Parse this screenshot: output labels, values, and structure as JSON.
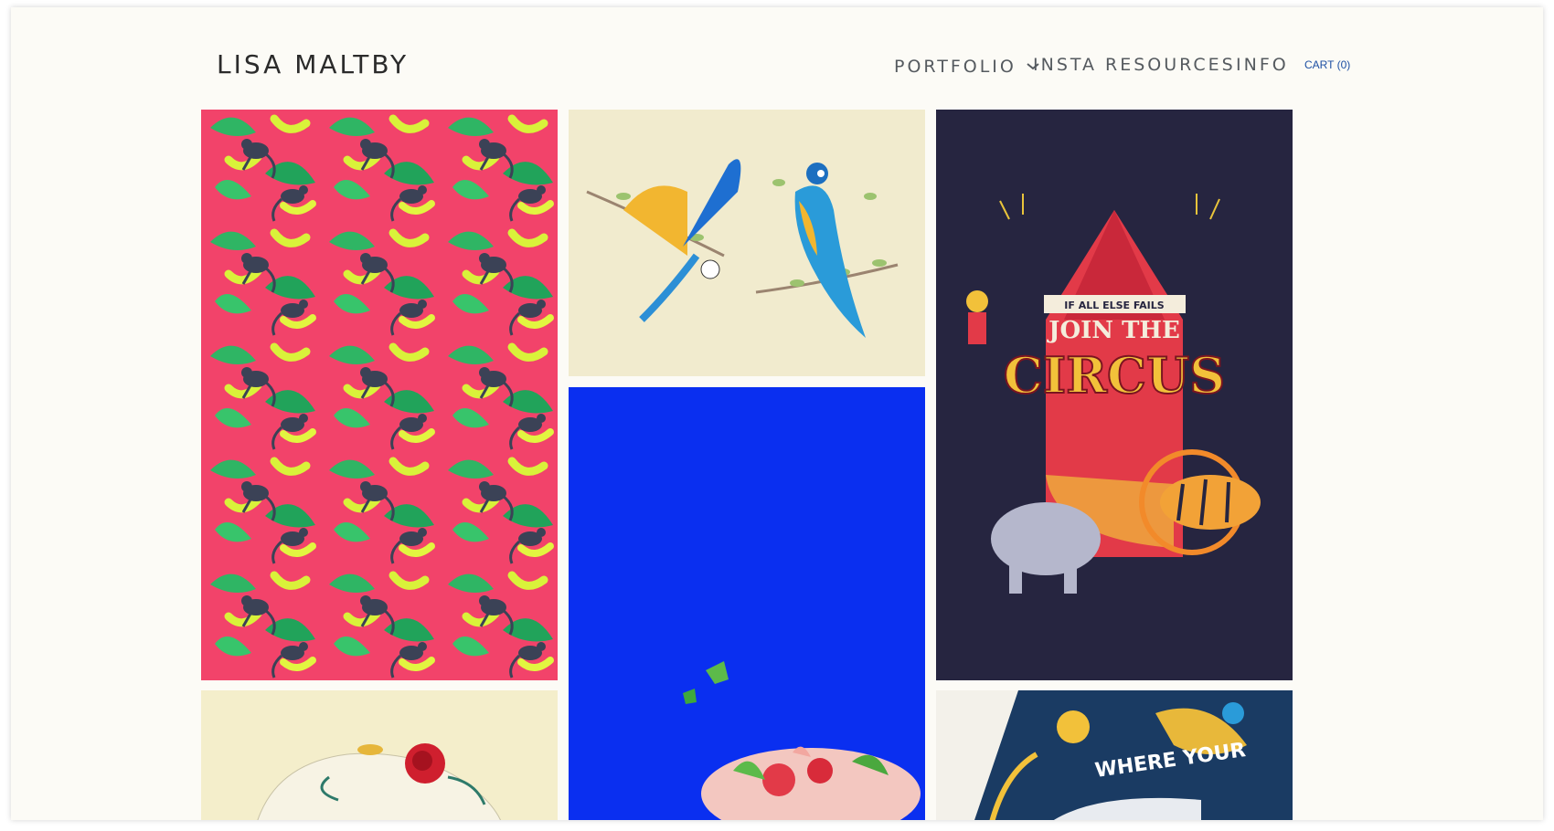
{
  "header": {
    "logo_text": "LISA MALTBY",
    "nav": {
      "portfolio": "PORTFOLIO",
      "insta": "INSTA",
      "resources": "RESOURCES",
      "info": "INFO",
      "cart": "CART (0)"
    },
    "portfolio_dropdown_icon": "chevron-down-icon"
  },
  "gallery": {
    "items": [
      {
        "name": "monkeys-bananas-pattern",
        "bg": "#f2436a"
      },
      {
        "name": "macaw-parrots",
        "bg": "#f1ebce"
      },
      {
        "name": "join-the-circus-poster",
        "bg": "#262540",
        "lettering": [
          "IF ALL ELSE FAILS",
          "JOIN THE",
          "CIRCUS"
        ]
      },
      {
        "name": "blue-food-illustration",
        "bg": "#0a2ff0"
      },
      {
        "name": "rose-illustration",
        "bg": "#f4eecb"
      },
      {
        "name": "where-your-mural",
        "bg": "#1a3b63",
        "lettering": [
          "WHERE YOUR"
        ]
      }
    ]
  },
  "colors": {
    "page_bg": "#fcfbf6",
    "nav_text": "#555a5f",
    "cart_link": "#1c4fa3",
    "logo_text": "#2b2b2b"
  }
}
